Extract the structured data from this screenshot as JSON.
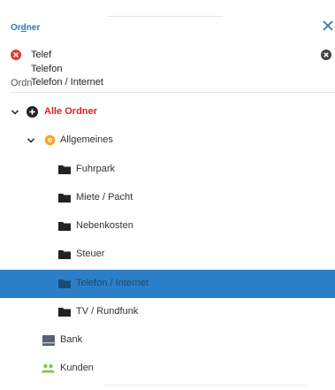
{
  "header": {
    "title_first": "Or",
    "title_underlined": "d",
    "title_rest": "ner"
  },
  "search": {
    "value": "Telef"
  },
  "suggestions": [
    "Telefon",
    "Telefon / Internet"
  ],
  "truncated_label": "Ordner",
  "tree": {
    "root": "Alle Ordner",
    "group": "Allgemeines",
    "folders": [
      "Fuhrpark",
      "Miete / Pacht",
      "Nebenkosten",
      "Steuer",
      "Telefon / Internet",
      "TV / Rundfunk"
    ],
    "bank": "Bank",
    "kunden": "Kunden"
  },
  "selected_folder": "Telefon / Internet",
  "colors": {
    "accent": "#2a7ab6",
    "selected_bg": "#2a7fc7",
    "root_red": "#e81c1c",
    "group_orange": "#f6a623",
    "kunden_green": "#8bc34a",
    "error_red": "#e53935"
  }
}
